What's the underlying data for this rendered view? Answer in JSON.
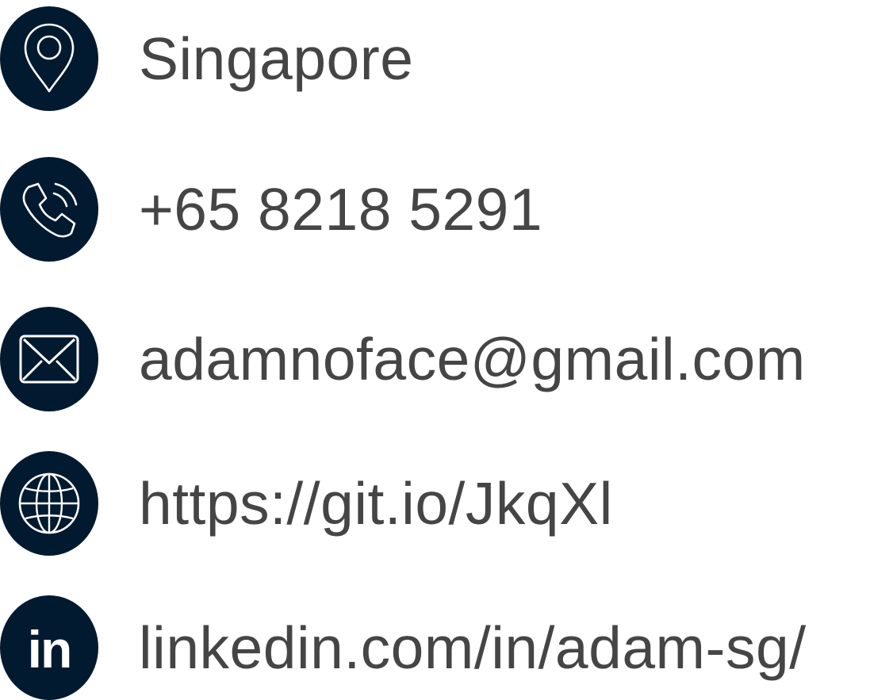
{
  "theme": {
    "icon_background": "#021a30",
    "icon_foreground": "#ffffff",
    "text_color": "#454545"
  },
  "contacts": [
    {
      "icon": "location-pin-icon",
      "text": "Singapore"
    },
    {
      "icon": "phone-icon",
      "text": "+65 8218 5291"
    },
    {
      "icon": "envelope-icon",
      "text": "adamnoface@gmail.com"
    },
    {
      "icon": "globe-icon",
      "text": "https://git.io/JkqXl"
    },
    {
      "icon": "linkedin-icon",
      "text": "linkedin.com/in/adam-sg/",
      "icon_glyph": "in"
    }
  ]
}
